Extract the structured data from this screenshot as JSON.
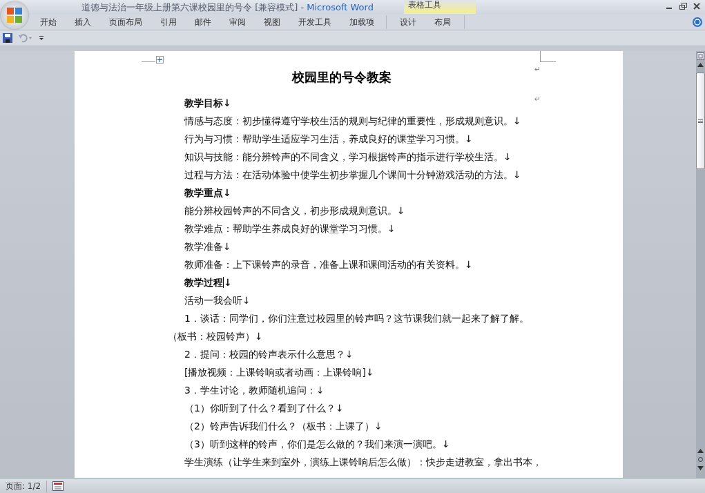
{
  "window": {
    "title": "道德与法治一年级上册第六课校园里的号令 [兼容模式]",
    "app_name": " - Microsoft Word"
  },
  "contextual_group": {
    "label": "表格工具"
  },
  "ribbon_tabs": [
    {
      "label": "开始",
      "selected": false
    },
    {
      "label": "插入",
      "selected": false
    },
    {
      "label": "页面布局",
      "selected": false
    },
    {
      "label": "引用",
      "selected": false
    },
    {
      "label": "邮件",
      "selected": false
    },
    {
      "label": "审阅",
      "selected": false
    },
    {
      "label": "视图",
      "selected": false
    },
    {
      "label": "开发工具",
      "selected": false
    },
    {
      "label": "加载项",
      "selected": false
    }
  ],
  "contextual_tabs": [
    {
      "label": "设计",
      "selected": false
    },
    {
      "label": "布局",
      "selected": false
    }
  ],
  "quick_access": {
    "undo_disabled": true
  },
  "document": {
    "title": "校园里的号令教案",
    "title_mark": "↵",
    "heading_mark": "↵",
    "lines": [
      {
        "kind": "heading",
        "text": "教学目标↓"
      },
      {
        "kind": "body",
        "text": "情感与态度：初步懂得遵守学校生活的规则与纪律的重要性，形成规则意识。↓"
      },
      {
        "kind": "body",
        "text": "行为与习惯：帮助学生适应学习生活，养成良好的课堂学习习惯。↓"
      },
      {
        "kind": "body",
        "text": "知识与技能：能分辨铃声的不同含义，学习根据铃声的指示进行学校生活。↓"
      },
      {
        "kind": "body",
        "text": "过程与方法：在活动体验中使学生初步掌握几个课间十分钟游戏活动的方法。↓"
      },
      {
        "kind": "heading",
        "text": "教学重点↓"
      },
      {
        "kind": "body",
        "text": "能分辨校园铃声的不同含义，初步形成规则意识。↓"
      },
      {
        "kind": "body",
        "text": "教学难点：帮助学生养成良好的课堂学习习惯。↓"
      },
      {
        "kind": "body",
        "text": "教学准备↓"
      },
      {
        "kind": "body",
        "text": "教师准备：上下课铃声的录音，准备上课和课间活动的有关资料。↓"
      },
      {
        "kind": "heading",
        "text": "教学过程↓",
        "cursor": true
      },
      {
        "kind": "body",
        "text": "活动一我会听↓"
      },
      {
        "kind": "body",
        "text": "1．谈话：同学们，你们注意过校园里的铃声吗？这节课我们就一起来了解了解。"
      },
      {
        "kind": "outdent",
        "text": "（板书：校园铃声）↓"
      },
      {
        "kind": "body",
        "text": "2．提问：校园的铃声表示什么意思？↓"
      },
      {
        "kind": "body",
        "text": "[播放视频：上课铃响或者动画：上课铃响]↓"
      },
      {
        "kind": "body",
        "text": "3．学生讨论，教师随机追问：↓"
      },
      {
        "kind": "body",
        "text": "（1）你听到了什么？看到了什么？↓"
      },
      {
        "kind": "body",
        "text": "（2）铃声告诉我们什么？（板书：上课了）↓"
      },
      {
        "kind": "body",
        "text": "（3）听到这样的铃声，你们是怎么做的？我们来演一演吧。↓"
      },
      {
        "kind": "body",
        "text": "学生演练（让学生来到室外，演练上课铃响后怎么做）：快步走进教室，拿出书本，"
      }
    ]
  },
  "status_bar": {
    "page": "页面: 1/2"
  }
}
